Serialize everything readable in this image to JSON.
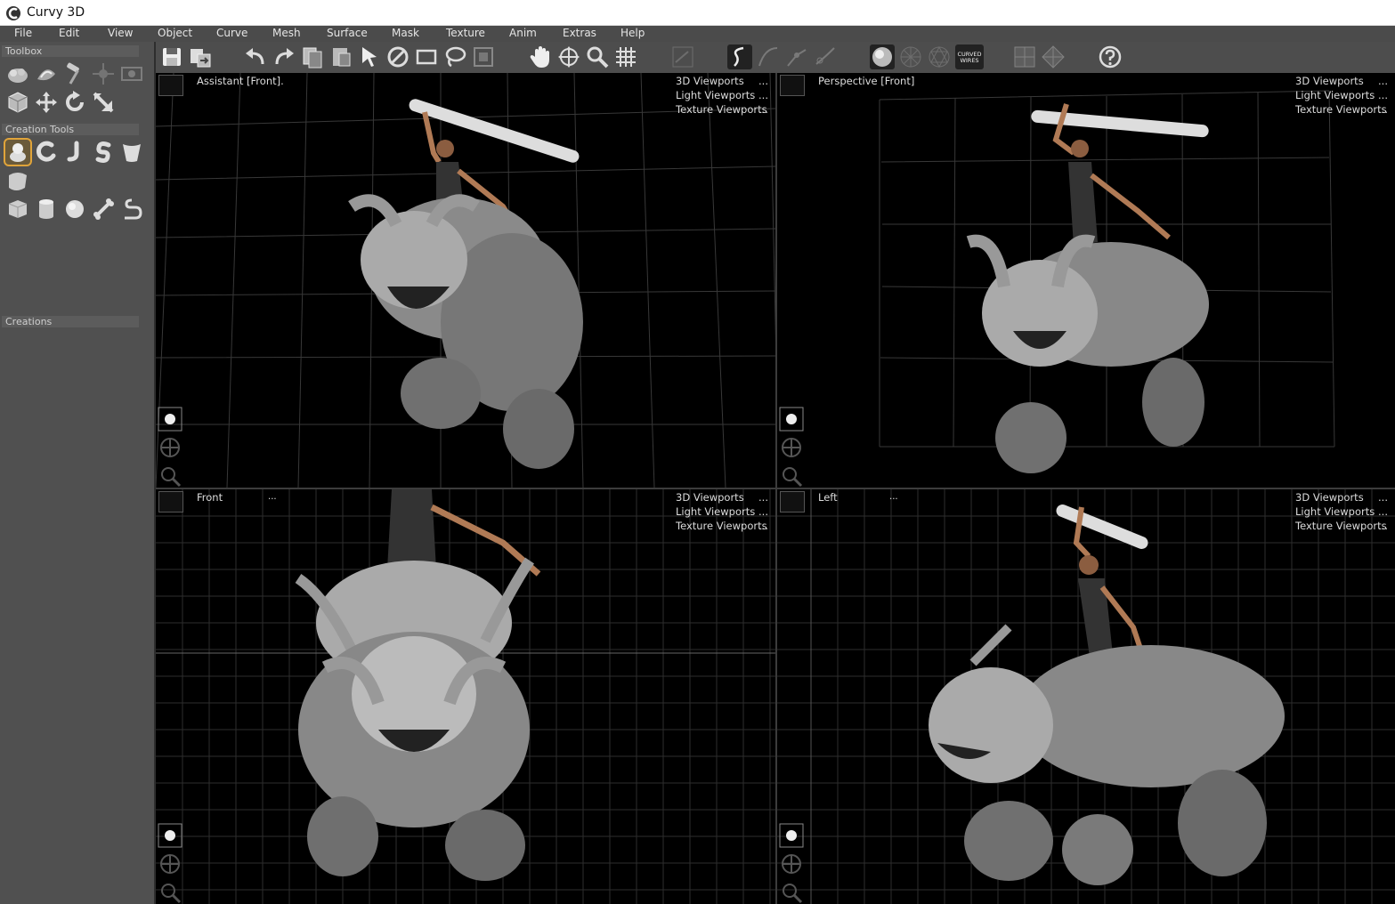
{
  "app": {
    "title": "Curvy 3D"
  },
  "menu": [
    "File",
    "Edit",
    "View",
    "Object",
    "Curve",
    "Mesh",
    "Surface",
    "Mask",
    "Texture",
    "Anim",
    "Extras",
    "Help"
  ],
  "left_panel": {
    "toolbox_label": "Toolbox",
    "creation_tools_label": "Creation Tools",
    "creations_label": "Creations"
  },
  "toolbar": {
    "curved_wires_label": "CURVED WIRES"
  },
  "viewports": [
    {
      "name": "Assistant [Front].",
      "options": [
        "3D Viewports",
        "Light Viewports",
        "Texture Viewports"
      ],
      "dots": [
        "...",
        "...",
        "..."
      ]
    },
    {
      "name": "Perspective [Front]",
      "options": [
        "3D Viewports",
        "Light Viewports",
        "Texture Viewports"
      ],
      "dots": [
        "...",
        "...",
        "..."
      ]
    },
    {
      "name": "Front",
      "options": [
        "3D Viewports",
        "Light Viewports",
        "Texture Viewports"
      ],
      "dots": [
        "...",
        "...",
        "..."
      ],
      "name_dots": "..."
    },
    {
      "name": "Left",
      "options": [
        "3D Viewports",
        "Light Viewports",
        "Texture Viewports"
      ],
      "dots": [
        "...",
        "...",
        "..."
      ],
      "name_dots": "..."
    }
  ],
  "colors": {
    "accent": "#e0a43a",
    "panel": "#505050",
    "viewport_bg": "#000000",
    "grid": "#3a3a3a"
  }
}
